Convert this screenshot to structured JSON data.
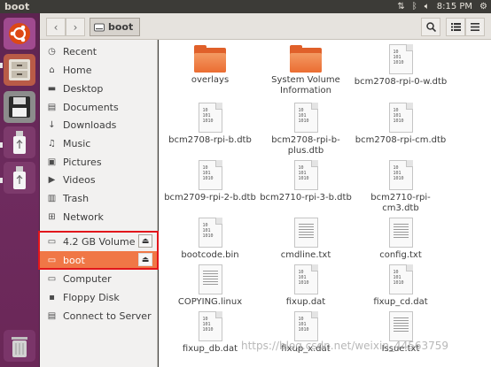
{
  "window": {
    "title": "boot"
  },
  "panel": {
    "time": "8:15 PM"
  },
  "header": {
    "path_label": "boot"
  },
  "sidebar": {
    "items": [
      {
        "label": "Recent",
        "icon": "clock-icon"
      },
      {
        "label": "Home",
        "icon": "home-icon"
      },
      {
        "label": "Desktop",
        "icon": "desktop-folder-icon"
      },
      {
        "label": "Documents",
        "icon": "documents-icon"
      },
      {
        "label": "Downloads",
        "icon": "download-arrow-icon"
      },
      {
        "label": "Music",
        "icon": "music-note-icon"
      },
      {
        "label": "Pictures",
        "icon": "pictures-icon"
      },
      {
        "label": "Videos",
        "icon": "video-icon"
      },
      {
        "label": "Trash",
        "icon": "trash-icon"
      },
      {
        "label": "Network",
        "icon": "network-icon"
      }
    ],
    "devices": [
      {
        "label": "4.2 GB Volume",
        "icon": "drive-icon"
      },
      {
        "label": "boot",
        "icon": "drive-icon"
      }
    ],
    "other": [
      {
        "label": "Computer",
        "icon": "computer-icon"
      },
      {
        "label": "Floppy Disk",
        "icon": "floppy-icon"
      },
      {
        "label": "Connect to Server",
        "icon": "server-icon"
      }
    ]
  },
  "files": [
    {
      "name": "overlays",
      "kind": "folder"
    },
    {
      "name": "System Volume Information",
      "kind": "folder"
    },
    {
      "name": "bcm2708-rpi-0-w.dtb",
      "kind": "binary"
    },
    {
      "name": "bcm2708-rpi-b.dtb",
      "kind": "binary"
    },
    {
      "name": "bcm2708-rpi-b-plus.dtb",
      "kind": "binary"
    },
    {
      "name": "bcm2708-rpi-cm.dtb",
      "kind": "binary"
    },
    {
      "name": "bcm2709-rpi-2-b.dtb",
      "kind": "binary"
    },
    {
      "name": "bcm2710-rpi-3-b.dtb",
      "kind": "binary"
    },
    {
      "name": "bcm2710-rpi-cm3.dtb",
      "kind": "binary"
    },
    {
      "name": "bootcode.bin",
      "kind": "binary"
    },
    {
      "name": "cmdline.txt",
      "kind": "text"
    },
    {
      "name": "config.txt",
      "kind": "text"
    },
    {
      "name": "COPYING.linux",
      "kind": "text"
    },
    {
      "name": "fixup.dat",
      "kind": "binary"
    },
    {
      "name": "fixup_cd.dat",
      "kind": "binary"
    },
    {
      "name": "fixup_db.dat",
      "kind": "binary"
    },
    {
      "name": "fixup_x.dat",
      "kind": "binary"
    },
    {
      "name": "Issue.txt",
      "kind": "text"
    }
  ],
  "binary_glyph": [
    "10",
    "101",
    "1010"
  ],
  "watermark": "https://blog.csdn.net/weixin_44563759",
  "colors": {
    "accent": "#f07746",
    "launcher": "#6a2757",
    "highlight": "#e2161b",
    "folder": "#eb6d32"
  }
}
